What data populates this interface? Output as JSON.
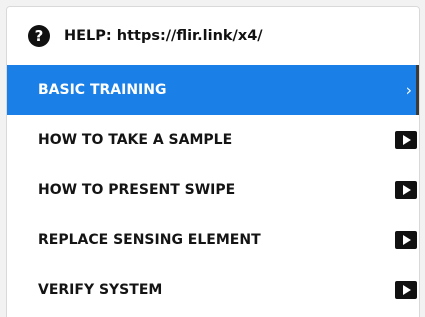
{
  "header": {
    "icon": "question-circle-icon",
    "text": "HELP: https://flir.link/x4/"
  },
  "menu": {
    "items": [
      {
        "label": "BASIC TRAINING",
        "icon": "chevron-right-icon",
        "selected": true
      },
      {
        "label": "HOW TO TAKE A SAMPLE",
        "icon": "play-icon",
        "selected": false
      },
      {
        "label": "HOW TO PRESENT SWIPE",
        "icon": "play-icon",
        "selected": false
      },
      {
        "label": "REPLACE SENSING ELEMENT",
        "icon": "play-icon",
        "selected": false
      },
      {
        "label": "VERIFY SYSTEM",
        "icon": "play-icon",
        "selected": false
      }
    ]
  },
  "colors": {
    "accent": "#1a7fe6",
    "text": "#141414",
    "background": "#ffffff"
  }
}
